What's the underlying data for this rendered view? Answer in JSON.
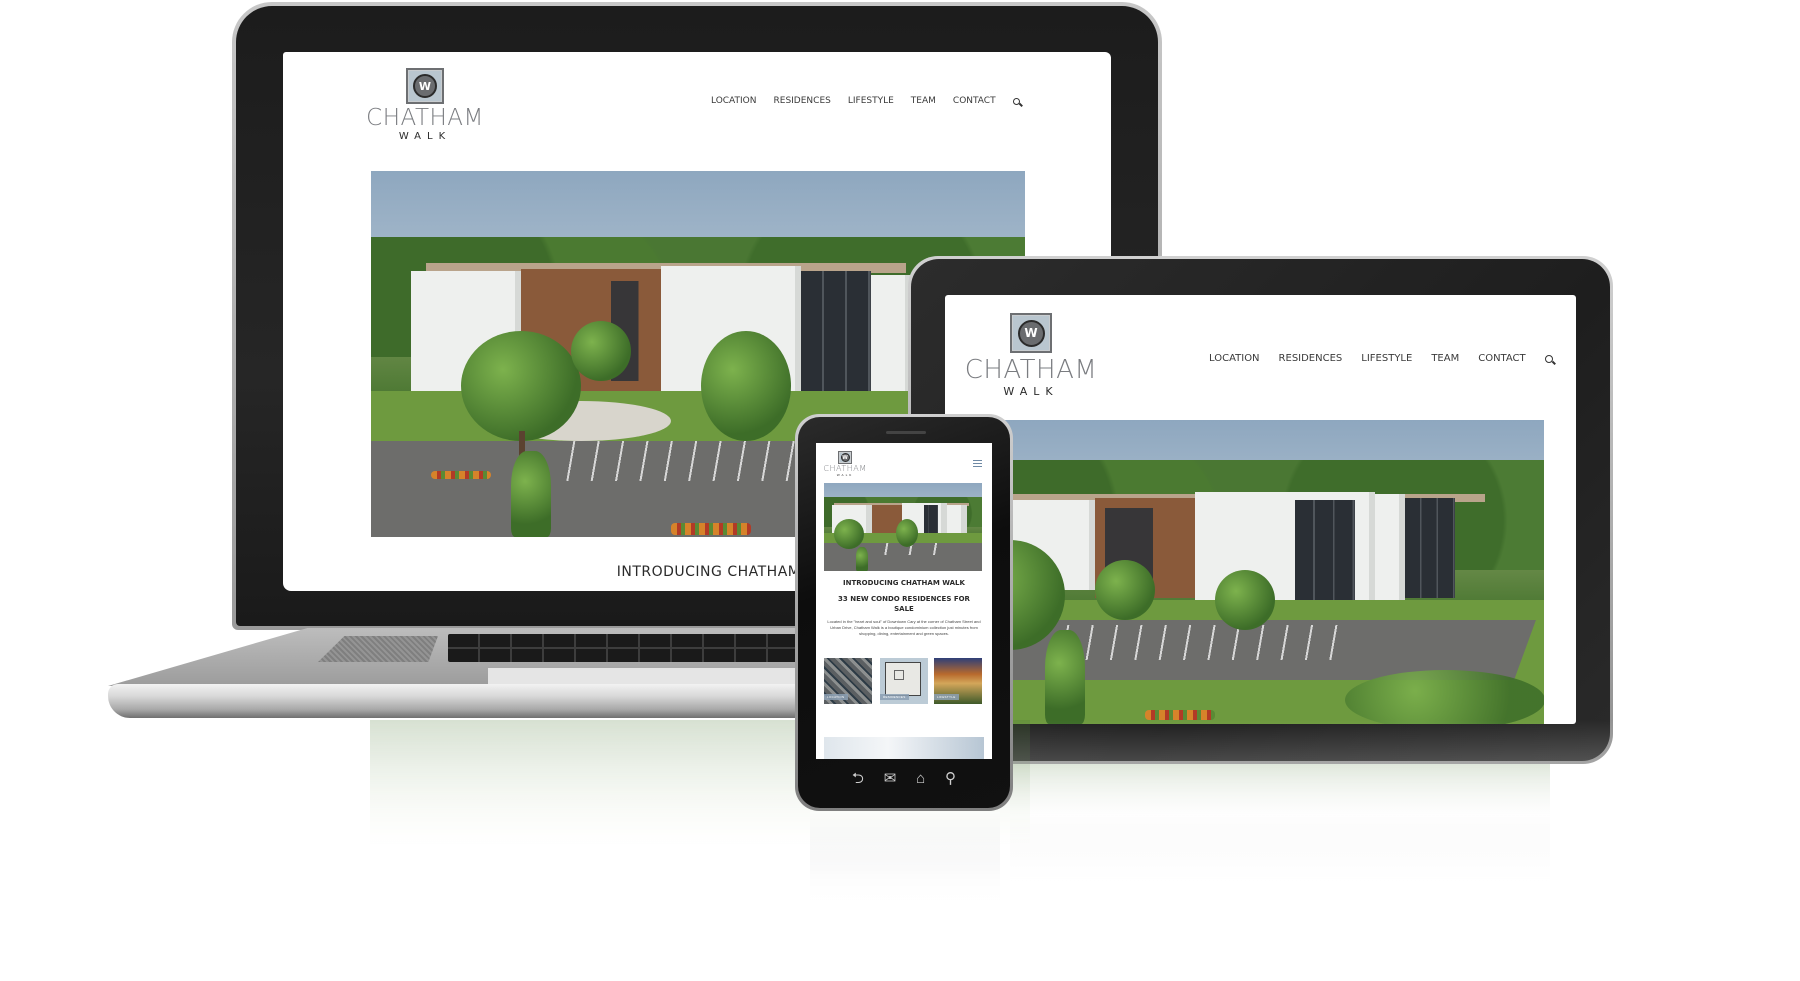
{
  "site": {
    "logo": {
      "monogram": "W",
      "name": "CHATHAM",
      "sub": "WALK"
    },
    "nav": [
      {
        "label": "LOCATION"
      },
      {
        "label": "RESIDENCES"
      },
      {
        "label": "LIFESTYLE"
      },
      {
        "label": "TEAM"
      },
      {
        "label": "CONTACT"
      }
    ],
    "search_icon": "search-icon",
    "menu_icon": "hamburger-menu-icon",
    "intro_heading": "INTRODUCING CHATHAM WALK",
    "sub_heading": "33 NEW CONDO RESIDENCES FOR SALE",
    "body_text": "Located in the \"heart and soul\" of Downtown Cary at the corner of Chatham Street and Urban Drive, Chatham Walk is a boutique condominium collection just minutes from shopping, dining, entertainment and green spaces.",
    "thumbnails": [
      {
        "label": "LOCATION",
        "kind": "aerial-map"
      },
      {
        "label": "RESIDENCES",
        "kind": "floor-plan"
      },
      {
        "label": "LIFESTYLE",
        "kind": "lifestyle-photo"
      }
    ]
  },
  "laptop": {
    "visible_heading": "INTRODUCING CHATHAM WAL"
  },
  "phone_nav": [
    {
      "icon": "back-icon",
      "glyph": "⮌"
    },
    {
      "icon": "mail-icon",
      "glyph": "✉"
    },
    {
      "icon": "home-icon",
      "glyph": "⌂"
    },
    {
      "icon": "search-icon",
      "glyph": "⚲"
    }
  ],
  "colors": {
    "logo_tile": "#b9c6cf",
    "logo_text": "#7a7c80",
    "nav_text": "#3a3a3a",
    "bezel": "#1f1f1f"
  }
}
